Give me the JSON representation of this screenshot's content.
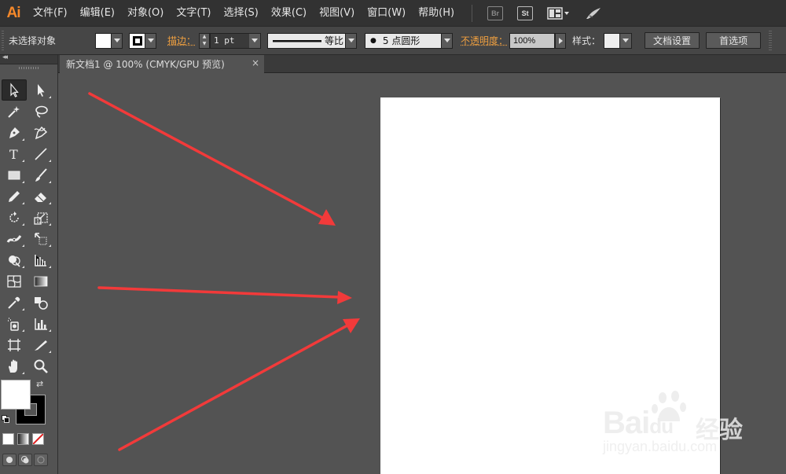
{
  "app": {
    "logo": "Ai"
  },
  "menu": [
    "文件(F)",
    "编辑(E)",
    "对象(O)",
    "文字(T)",
    "选择(S)",
    "效果(C)",
    "视图(V)",
    "窗口(W)",
    "帮助(H)"
  ],
  "menubar_icons": {
    "bridge": "Br",
    "stock": "St",
    "arrange": "arrange-documents-icon",
    "sync": "brush-sync-icon"
  },
  "controlbar": {
    "selection_label": "未选择对象",
    "stroke_label": "描边：",
    "stroke_weight": "1 pt",
    "stroke_profile": "等比",
    "brush": "5 点圆形",
    "opacity_label": "不透明度：",
    "opacity_value": "100%",
    "style_label": "样式：",
    "doc_setup": "文档设置",
    "preferences": "首选项"
  },
  "document_tab": {
    "title": "新文档1 @ 100% (CMYK/GPU 预览)",
    "close": "×"
  },
  "colors": {
    "arrow": "#f23a3a",
    "accent": "#f0a040",
    "canvas": "#535353",
    "artboard": "#ffffff"
  },
  "watermark": {
    "brand": "Bai",
    "brand_paw": "du",
    "cn": "经验",
    "url": "jingyan.baidu.com"
  }
}
